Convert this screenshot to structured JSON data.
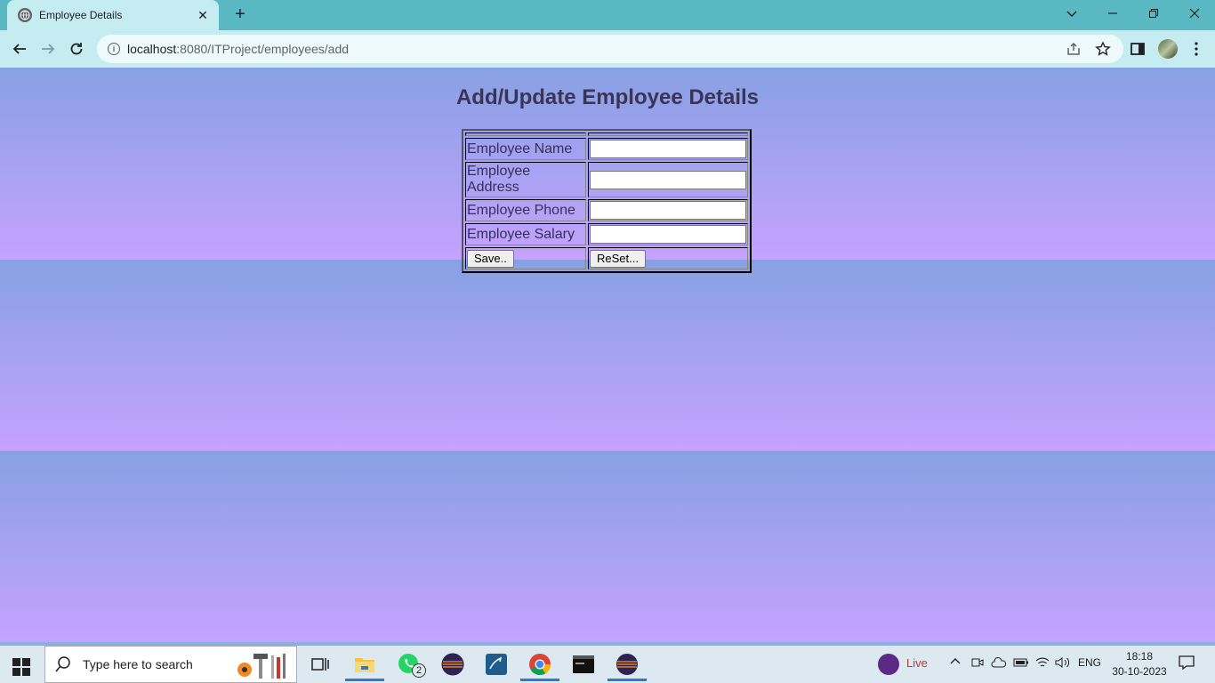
{
  "browser": {
    "tab_title": "Employee Details",
    "new_tab_label": "+",
    "url_host": "localhost",
    "url_rest": ":8080/ITProject/employees/add"
  },
  "page": {
    "heading": "Add/Update Employee Details",
    "form": {
      "rows": [
        {
          "label": "Employee Name",
          "value": ""
        },
        {
          "label": "Employee Address",
          "value": ""
        },
        {
          "label": "Employee Phone",
          "value": ""
        },
        {
          "label": "Employee Salary",
          "value": ""
        }
      ],
      "save_label": "Save..",
      "reset_label": "ReSet..."
    }
  },
  "taskbar": {
    "search_placeholder": "Type here to search",
    "whatsapp_badge": "2",
    "live_label": "Live",
    "language": "ENG",
    "time": "18:18",
    "date": "30-10-2023"
  },
  "colors": {
    "gradient_top": "#87a1e4",
    "gradient_bottom": "#c5a2fe",
    "chrome_frame": "#5ab8c2",
    "chrome_toolbar": "#c4ecf1"
  }
}
